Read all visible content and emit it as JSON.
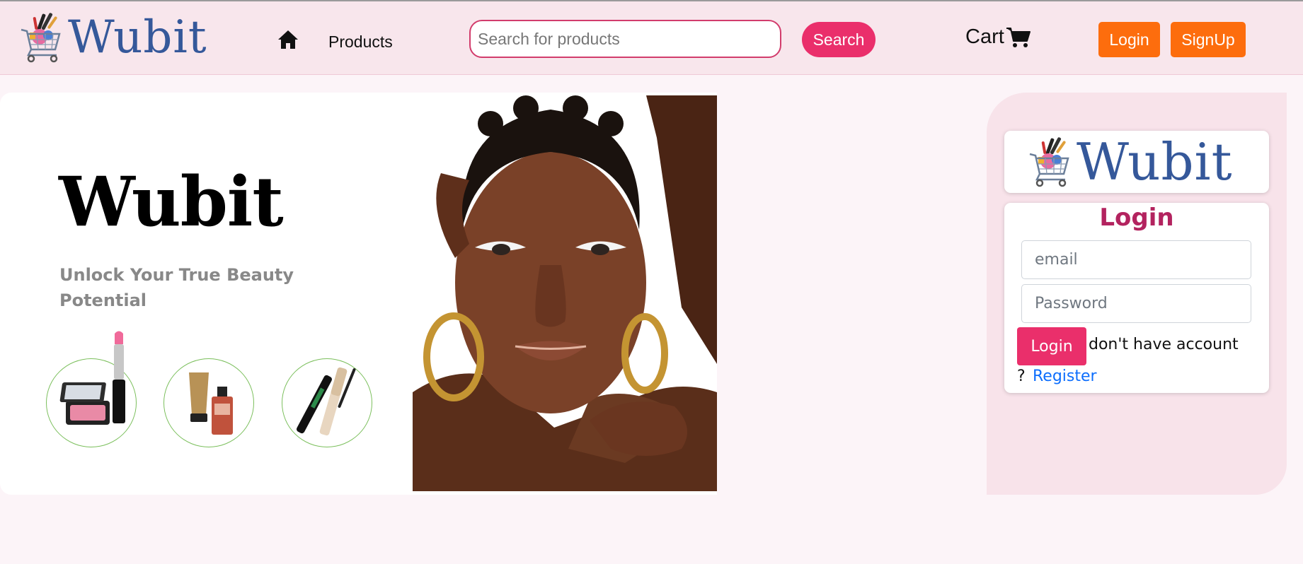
{
  "navbar": {
    "brand": "Wubit",
    "products_label": "Products",
    "search_placeholder": "Search for products",
    "search_label": "Search",
    "cart_label": "Cart",
    "login_label": "Login",
    "signup_label": "SignUp"
  },
  "hero": {
    "title": "Wubit",
    "tagline": "Unlock Your True Beauty Potential",
    "products": [
      "blush-compact-lipstick",
      "lotion-perfume",
      "mascara"
    ]
  },
  "login_panel": {
    "brand": "Wubit",
    "heading": "Login",
    "email_placeholder": "email",
    "password_placeholder": "Password",
    "login_label": "Login",
    "no_account_text": "don't have account",
    "question_mark": "?",
    "register_label": "Register"
  },
  "colors": {
    "brand_blue": "#35589a",
    "accent_pink": "#ea2f6b",
    "heading_pink": "#b3235f",
    "orange": "#fd6d0d",
    "navbar_bg": "#f8e6ec",
    "panel_bg": "#f8e3ea",
    "link_blue": "#0d6efd"
  },
  "icons": [
    "shopping-cart-logo-icon",
    "home-icon",
    "cart-icon"
  ]
}
